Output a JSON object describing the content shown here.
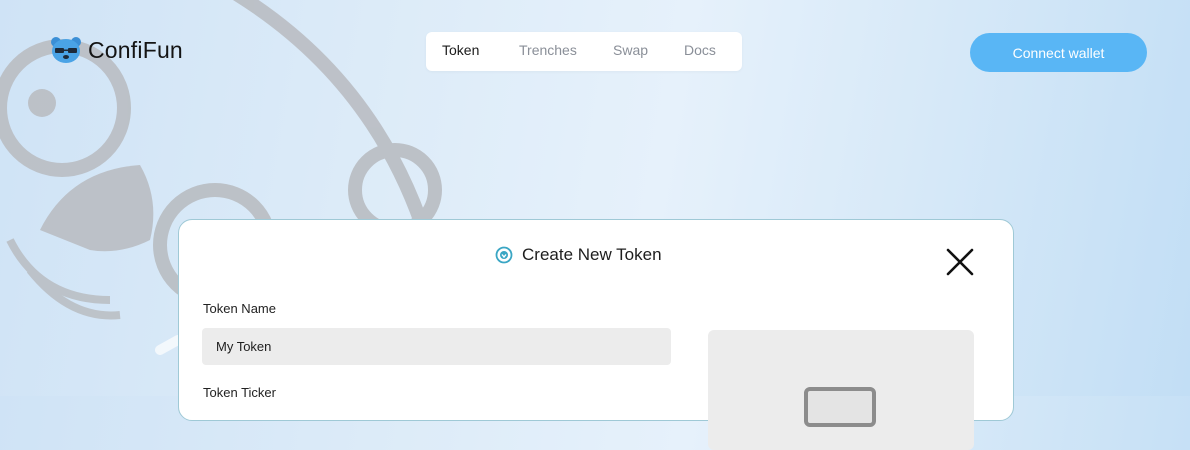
{
  "brand": {
    "name": "ConfiFun",
    "logo_icon": "bear-face-icon"
  },
  "nav": {
    "items": [
      {
        "label": "Token",
        "active": true
      },
      {
        "label": "Trenches",
        "active": false
      },
      {
        "label": "Swap",
        "active": false
      },
      {
        "label": "Docs",
        "active": false
      }
    ]
  },
  "header": {
    "connect_label": "Connect wallet"
  },
  "modal": {
    "title": "Create New Token",
    "title_icon": "token-badge-icon",
    "close_icon": "close-icon",
    "fields": {
      "token_name": {
        "label": "Token Name",
        "value": "My Token"
      },
      "token_ticker": {
        "label": "Token Ticker"
      }
    },
    "upload_icon": "image-upload-icon"
  },
  "colors": {
    "accent": "#59b6f5",
    "modal_border": "#9fc9d6",
    "input_bg": "#ececec"
  }
}
